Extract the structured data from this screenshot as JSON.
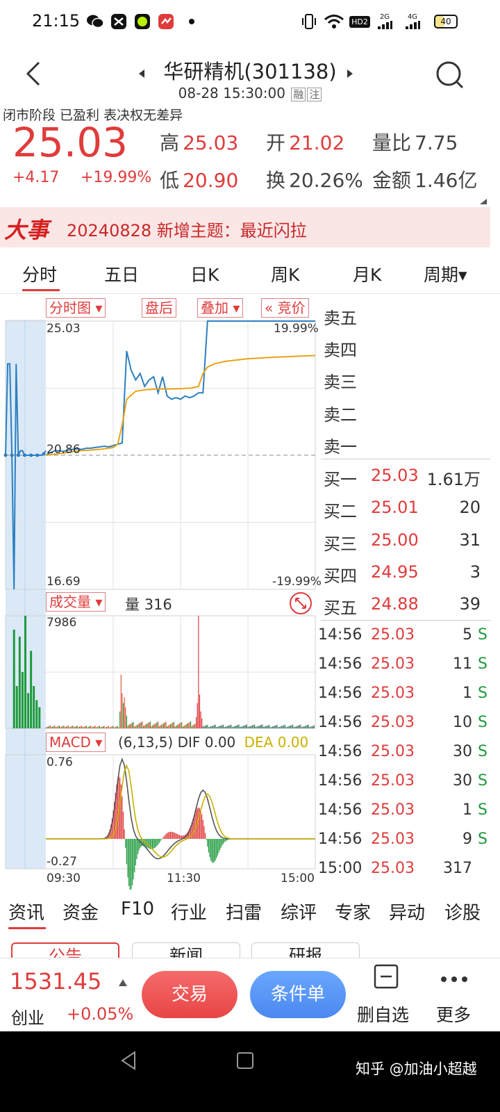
{
  "status_bar": {
    "time": "21:15",
    "battery": "40",
    "net_labels": [
      "HD2",
      "2G",
      "4G"
    ]
  },
  "header": {
    "title": "华研精机(301138)",
    "datetime": "08-28 15:30:00",
    "tag1": "融",
    "tag2": "注"
  },
  "quote": {
    "status_line": "闭市阶段  已盈利  表决权无差异",
    "price": "25.03",
    "change": "+4.17",
    "change_pct": "+19.99%",
    "high_label": "高",
    "high": "25.03",
    "open_label": "开",
    "open": "21.02",
    "volume_ratio_label": "量比",
    "volume_ratio": "7.75",
    "low_label": "低",
    "low": "20.90",
    "turnover_label": "换",
    "turnover": "20.26%",
    "amount_label": "金额",
    "amount": "1.46亿"
  },
  "news_banner": {
    "badge": "大事",
    "text": "20240828 新增主题：最近闪拉"
  },
  "tabs": [
    "分时",
    "五日",
    "日K",
    "周K",
    "月K",
    "周期▾"
  ],
  "chart_controls": {
    "type_btn": "分时图 ▾",
    "after_btn": "盘后",
    "overlay_btn": "叠加 ▾",
    "auction_btn": "« 竞价"
  },
  "chart_data": [
    {
      "type": "line",
      "title": "",
      "y_top": "25.03",
      "y_mid": "20.86",
      "y_bottom": "16.69",
      "pct_top": "19.99%",
      "pct_bottom": "-19.99%",
      "ylim": [
        16.69,
        25.03
      ],
      "series": [
        {
          "name": "",
          "color": "#2c7fc0",
          "x": [
            0,
            4,
            8,
            12,
            16,
            20,
            24,
            28,
            32,
            36,
            40,
            44,
            48,
            52,
            56,
            60,
            64,
            68,
            72,
            76,
            80,
            84,
            88,
            92,
            96,
            100,
            104,
            108,
            112,
            116,
            120,
            124,
            128,
            132,
            136,
            140,
            144,
            148,
            152,
            156,
            160,
            164,
            168,
            172,
            176,
            180,
            184,
            188,
            192,
            196,
            200,
            204,
            208,
            212,
            216,
            220,
            224,
            228,
            232,
            236,
            240
          ],
          "y": [
            20.86,
            20.94,
            21.0,
            21.0,
            20.98,
            21.02,
            21.04,
            21.06,
            21.04,
            21.08,
            21.08,
            21.1,
            21.12,
            21.14,
            21.12,
            21.16,
            21.2,
            21.24,
            24.1,
            23.5,
            23.2,
            23.4,
            23.0,
            23.2,
            23.3,
            22.8,
            23.3,
            22.7,
            22.6,
            22.65,
            22.6,
            22.7,
            22.65,
            22.7,
            22.8,
            22.8,
            25.03,
            25.03,
            25.03,
            25.03,
            25.03,
            25.03,
            25.03,
            25.03,
            25.03,
            25.03,
            25.03,
            25.03,
            25.03,
            25.03,
            25.03,
            25.03,
            25.03,
            25.03,
            25.03,
            25.03,
            25.03,
            25.03,
            25.03,
            25.03,
            25.03
          ]
        },
        {
          "name": "",
          "color": "#e8a317",
          "x": [
            0,
            10,
            20,
            30,
            40,
            50,
            60,
            64,
            68,
            72,
            80,
            90,
            100,
            110,
            120,
            130,
            136,
            140,
            144,
            150,
            160,
            170,
            180,
            200,
            220,
            240
          ],
          "y": [
            20.86,
            20.9,
            20.95,
            21.0,
            21.02,
            21.05,
            21.1,
            21.2,
            21.8,
            22.6,
            22.85,
            22.9,
            22.92,
            22.92,
            22.93,
            22.95,
            23.0,
            23.4,
            23.6,
            23.7,
            23.78,
            23.82,
            23.86,
            23.9,
            23.93,
            23.96
          ]
        }
      ],
      "pre_market": {
        "x": [
          0,
          3,
          6,
          9,
          12,
          15,
          18,
          21,
          24,
          27,
          30,
          33,
          36,
          39,
          42,
          45,
          48,
          51,
          54,
          57
        ],
        "y": [
          20.86,
          23.7,
          23.7,
          20.86,
          16.69,
          23.7,
          20.86,
          21.0,
          21.0,
          20.86,
          20.86,
          20.86,
          20.86,
          20.86,
          20.86,
          20.86,
          20.86,
          20.86,
          20.9,
          21.0
        ]
      }
    },
    {
      "type": "bar",
      "title": "",
      "label_btn": "成交量 ▾",
      "volume_label": "量",
      "volume_value": "316",
      "y_top": "7986",
      "ylim": [
        0,
        7986
      ]
    },
    {
      "type": "line",
      "title": "",
      "label_btn": "MACD ▾",
      "params": "(6,13,5)",
      "dif_label": "DIF",
      "dif": "0.00",
      "dea_label": "DEA",
      "dea": "0.00",
      "y_top": "0.76",
      "y_bottom": "-0.27",
      "ylim": [
        -0.27,
        0.76
      ],
      "x_labels": [
        "09:30",
        "11:30",
        "15:00"
      ]
    }
  ],
  "order_book": {
    "asks": [
      {
        "label": "卖五",
        "price": "",
        "vol": ""
      },
      {
        "label": "卖四",
        "price": "",
        "vol": ""
      },
      {
        "label": "卖三",
        "price": "",
        "vol": ""
      },
      {
        "label": "卖二",
        "price": "",
        "vol": ""
      },
      {
        "label": "卖一",
        "price": "",
        "vol": ""
      }
    ],
    "bids": [
      {
        "label": "买一",
        "price": "25.03",
        "vol": "1.61万"
      },
      {
        "label": "买二",
        "price": "25.01",
        "vol": "20"
      },
      {
        "label": "买三",
        "price": "25.00",
        "vol": "31"
      },
      {
        "label": "买四",
        "price": "24.95",
        "vol": "3"
      },
      {
        "label": "买五",
        "price": "24.88",
        "vol": "39"
      }
    ]
  },
  "ticks": [
    {
      "time": "14:56",
      "price": "25.03",
      "vol": "5",
      "side": "S"
    },
    {
      "time": "14:56",
      "price": "25.03",
      "vol": "11",
      "side": "S"
    },
    {
      "time": "14:56",
      "price": "25.03",
      "vol": "1",
      "side": "S"
    },
    {
      "time": "14:56",
      "price": "25.03",
      "vol": "10",
      "side": "S"
    },
    {
      "time": "14:56",
      "price": "25.03",
      "vol": "30",
      "side": "S"
    },
    {
      "time": "14:56",
      "price": "25.03",
      "vol": "30",
      "side": "S"
    },
    {
      "time": "14:56",
      "price": "25.03",
      "vol": "1",
      "side": "S"
    },
    {
      "time": "14:56",
      "price": "25.03",
      "vol": "9",
      "side": "S"
    },
    {
      "time": "15:00",
      "price": "25.03",
      "vol": "317",
      "side": ""
    }
  ],
  "bottom_tabs": [
    "资讯",
    "资金",
    "F10",
    "行业",
    "扫雷",
    "综评",
    "专家",
    "异动",
    "诊股"
  ],
  "sub_tabs": [
    "公告",
    "新闻",
    "研报"
  ],
  "bottom_bar": {
    "index_value": "1531.45",
    "index_name": "创业",
    "index_change": "+0.05%",
    "trade_btn": "交易",
    "condition_btn": "条件单",
    "remove_label": "删自选",
    "more_label": "更多"
  },
  "watermark": "知乎 @加油小超越",
  "colors": {
    "up": "#e03b3b",
    "down": "#1e9a3c",
    "price_line": "#2c7fc0",
    "avg_line": "#e8a317",
    "banner_bg": "#fbe6e6"
  }
}
